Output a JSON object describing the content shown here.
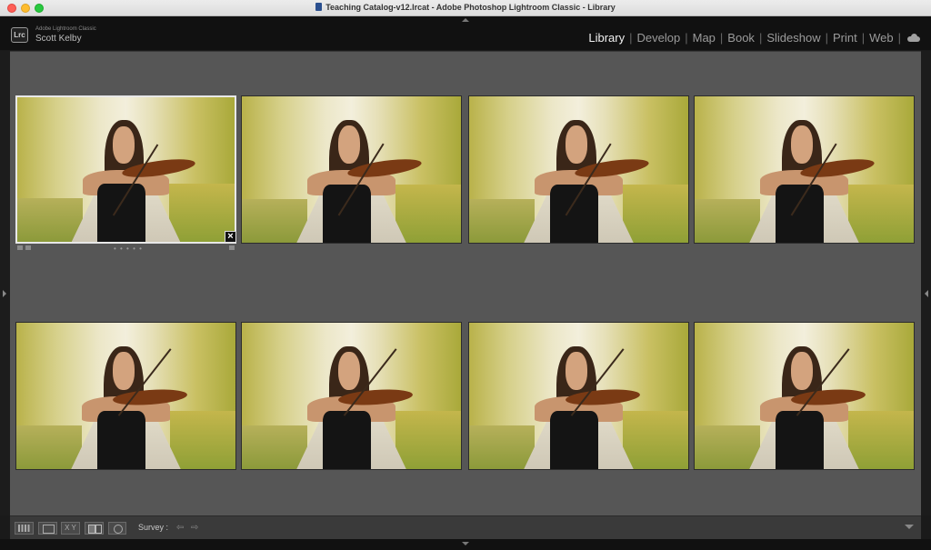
{
  "window": {
    "title": "Teaching Catalog-v12.lrcat - Adobe Photoshop Lightroom Classic - Library"
  },
  "identity": {
    "badge": "Lrc",
    "product": "Adobe Lightroom Classic",
    "user": "Scott Kelby"
  },
  "modules": [
    {
      "label": "Library",
      "active": true
    },
    {
      "label": "Develop",
      "active": false
    },
    {
      "label": "Map",
      "active": false
    },
    {
      "label": "Book",
      "active": false
    },
    {
      "label": "Slideshow",
      "active": false
    },
    {
      "label": "Print",
      "active": false
    },
    {
      "label": "Web",
      "active": false
    }
  ],
  "survey": {
    "photo_count": 8,
    "selected_index": 0,
    "photo_subject": "violinist-portrait",
    "thumbnail_rating_dots": "• • • • •",
    "remove_icon_label": "×"
  },
  "toolbar": {
    "view_label": "Survey :",
    "compare_label": "X Y",
    "prev_arrow": "⇦",
    "next_arrow": "⇨"
  },
  "icons": {
    "grid_view": "grid-icon",
    "loupe_view": "loupe-icon",
    "compare_view": "compare-icon",
    "survey_view": "survey-icon",
    "people_view": "people-icon",
    "cloud": "cloud-sync-icon"
  },
  "colors": {
    "accent_active": "#f0f0f0",
    "module_inactive": "#9b9b9b",
    "grid_background": "#565656"
  }
}
